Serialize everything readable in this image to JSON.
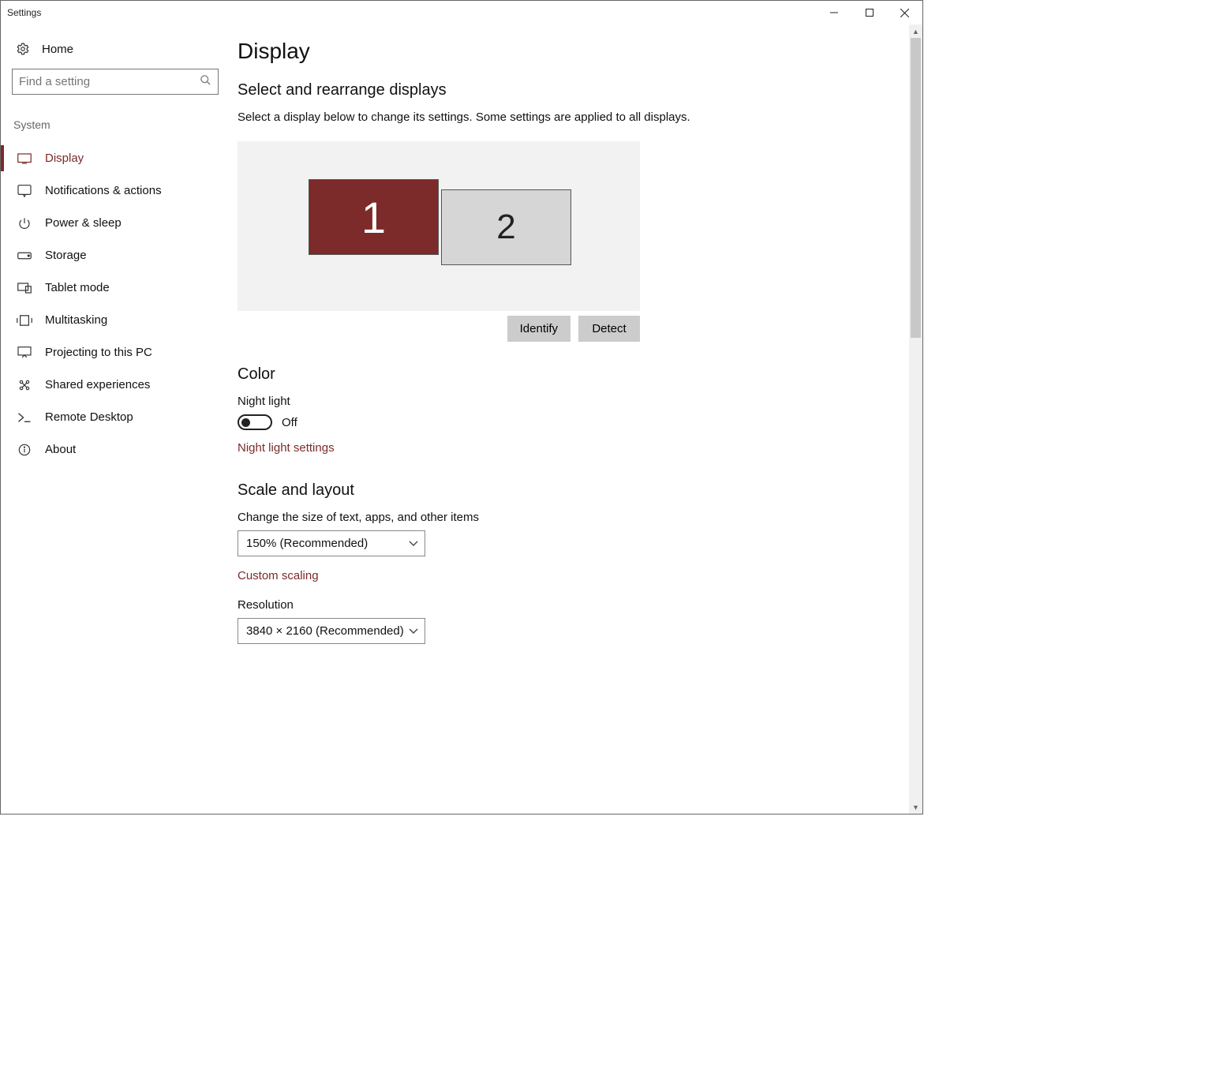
{
  "window": {
    "title": "Settings"
  },
  "sidebar": {
    "home_label": "Home",
    "search_placeholder": "Find a setting",
    "category": "System",
    "items": [
      {
        "label": "Display",
        "icon": "display-icon",
        "active": true
      },
      {
        "label": "Notifications & actions",
        "icon": "notifications-icon"
      },
      {
        "label": "Power & sleep",
        "icon": "power-icon"
      },
      {
        "label": "Storage",
        "icon": "storage-icon"
      },
      {
        "label": "Tablet mode",
        "icon": "tablet-icon"
      },
      {
        "label": "Multitasking",
        "icon": "multitasking-icon"
      },
      {
        "label": "Projecting to this PC",
        "icon": "projecting-icon"
      },
      {
        "label": "Shared experiences",
        "icon": "shared-icon"
      },
      {
        "label": "Remote Desktop",
        "icon": "remote-icon"
      },
      {
        "label": "About",
        "icon": "about-icon"
      }
    ]
  },
  "page": {
    "title": "Display",
    "arrange": {
      "heading": "Select and rearrange displays",
      "description": "Select a display below to change its settings. Some settings are applied to all displays.",
      "monitors": [
        {
          "id": "1",
          "selected": true
        },
        {
          "id": "2",
          "selected": false
        }
      ],
      "identify_label": "Identify",
      "detect_label": "Detect"
    },
    "color": {
      "heading": "Color",
      "night_light_label": "Night light",
      "night_light_state": "Off",
      "night_light_on": false,
      "night_light_settings_link": "Night light settings"
    },
    "scale": {
      "heading": "Scale and layout",
      "size_label": "Change the size of text, apps, and other items",
      "size_value": "150% (Recommended)",
      "custom_scaling_link": "Custom scaling",
      "resolution_label": "Resolution",
      "resolution_value": "3840 × 2160 (Recommended)"
    }
  },
  "colors": {
    "accent": "#7d2a2a"
  }
}
